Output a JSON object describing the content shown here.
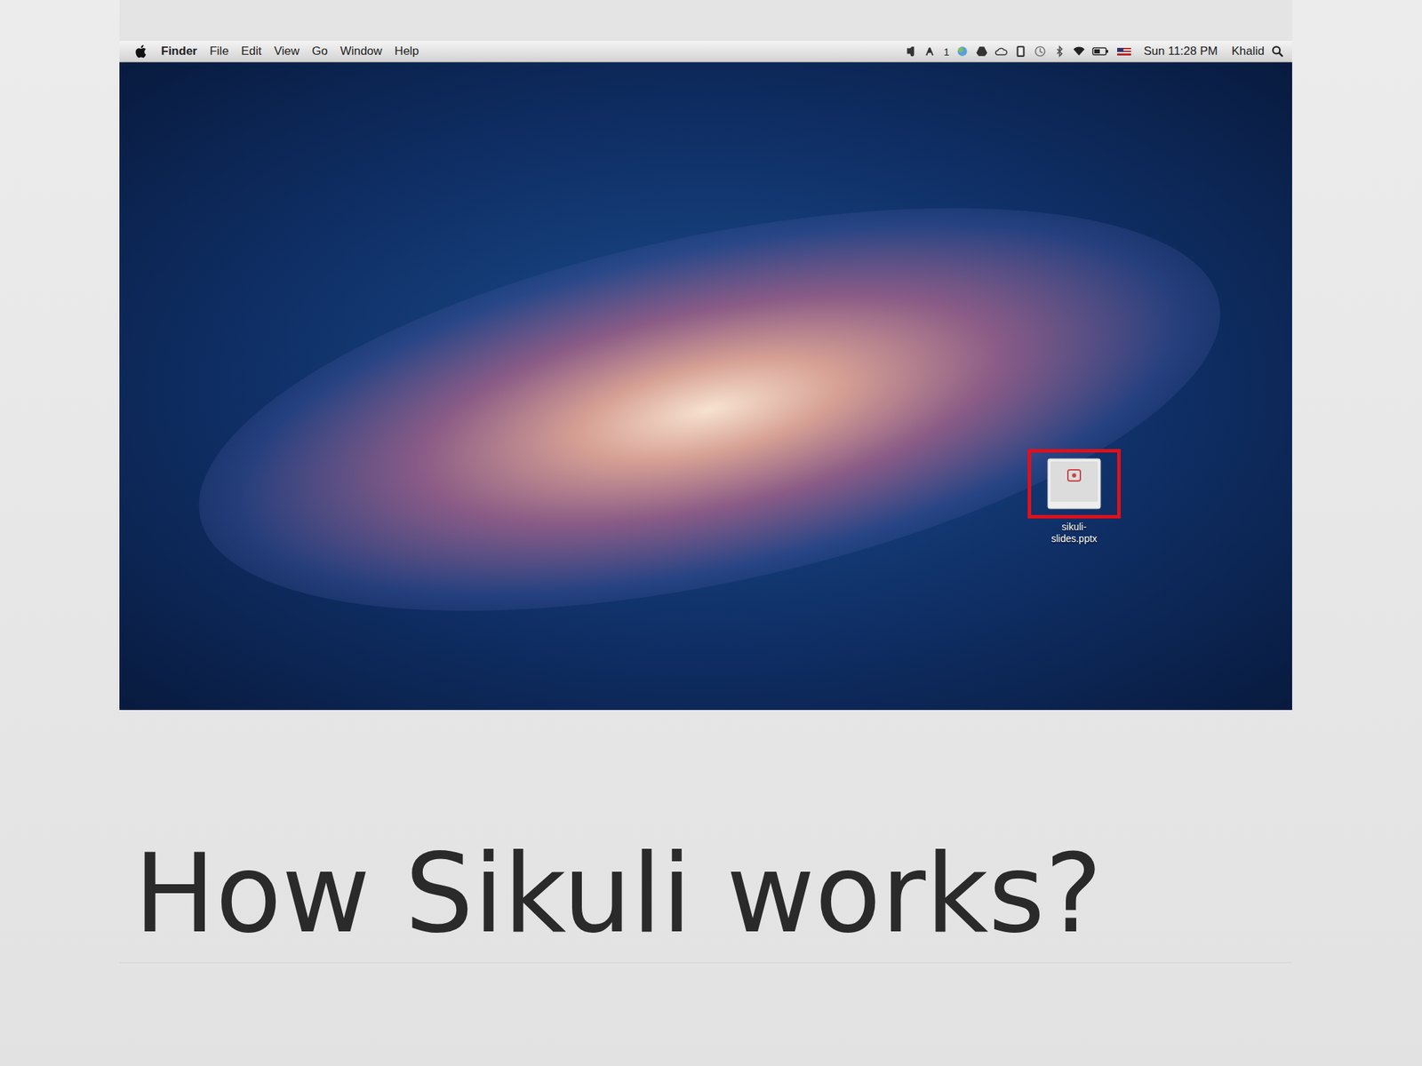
{
  "slide": {
    "title": "How Sikuli works?"
  },
  "menu_bar": {
    "app": "Finder",
    "menus": [
      "File",
      "Edit",
      "View",
      "Go",
      "Window",
      "Help"
    ],
    "status_badge": "1",
    "clock": "Sun 11:28 PM",
    "user": "Khalid"
  },
  "desktop": {
    "icons": [
      {
        "label": "sikuli-slides.pptx",
        "highlighted": true
      }
    ]
  }
}
